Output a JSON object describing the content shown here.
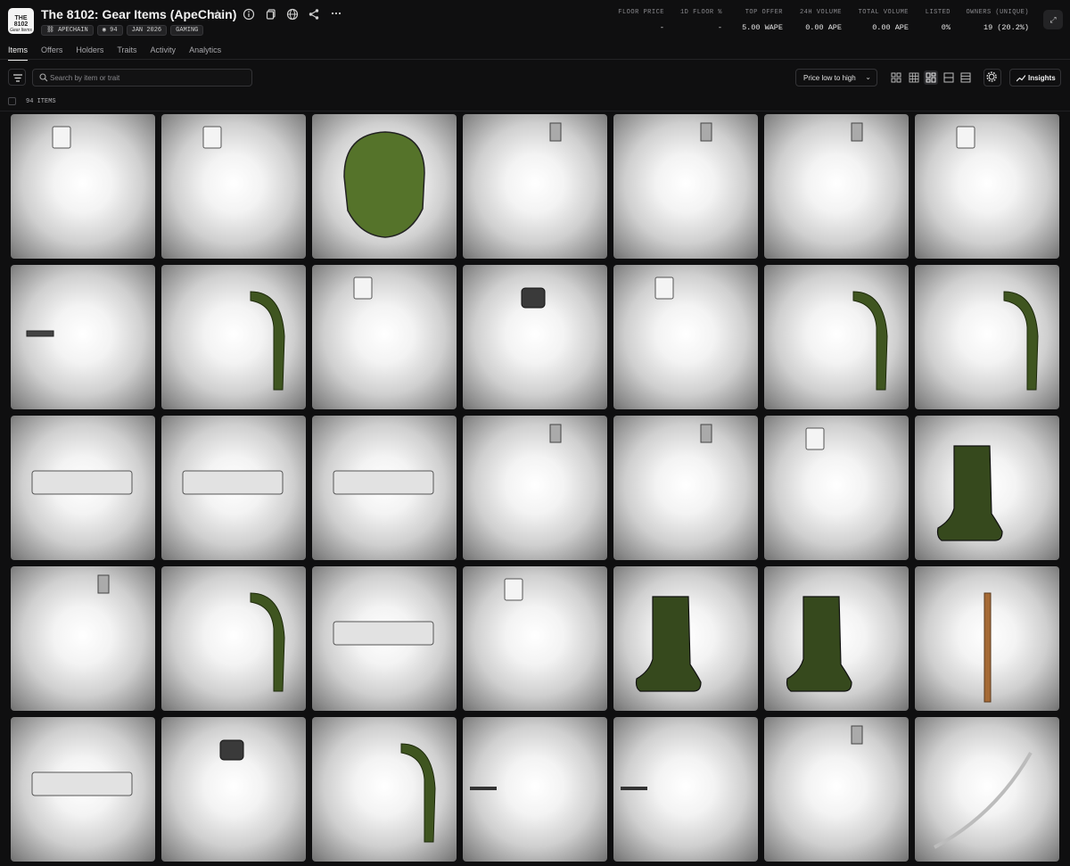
{
  "header": {
    "logo_line1": "THE 8102",
    "logo_line2": "Gear Items",
    "title": "The 8102: Gear Items (ApeChain)",
    "tags": [
      "APECHAIN",
      "94",
      "JAN 2026",
      "GAMING"
    ]
  },
  "stats": [
    {
      "label": "FLOOR PRICE",
      "value": "-"
    },
    {
      "label": "1D FLOOR %",
      "value": "-"
    },
    {
      "label": "TOP OFFER",
      "value": "5.00 WAPE"
    },
    {
      "label": "24H VOLUME",
      "value": "0.00 APE"
    },
    {
      "label": "TOTAL VOLUME",
      "value": "0.00 APE"
    },
    {
      "label": "LISTED",
      "value": "0%"
    },
    {
      "label": "OWNERS (UNIQUE)",
      "value": "19 (20.2%)"
    }
  ],
  "tabs": [
    "Items",
    "Offers",
    "Holders",
    "Traits",
    "Activity",
    "Analytics"
  ],
  "active_tab": "Items",
  "search": {
    "placeholder": "Search by item or trait"
  },
  "sort": {
    "selected": "Price low to high"
  },
  "insights_label": "Insights",
  "item_count": "94 ITEMS",
  "items": [
    "hammer",
    "hammer",
    "helmet",
    "flail",
    "flail",
    "flail",
    "hammer",
    "rifle",
    "backpack",
    "hammer",
    "grenade",
    "hammer",
    "backpack",
    "backpack",
    "pistol",
    "pistol",
    "pistol",
    "flail",
    "flail",
    "hammer",
    "boots",
    "flail",
    "backpack",
    "pistol",
    "hammer",
    "boots",
    "boots",
    "axe",
    "pistol",
    "grenade",
    "backpack",
    "green-rifle",
    "green-rifle",
    "flail",
    "katana"
  ]
}
